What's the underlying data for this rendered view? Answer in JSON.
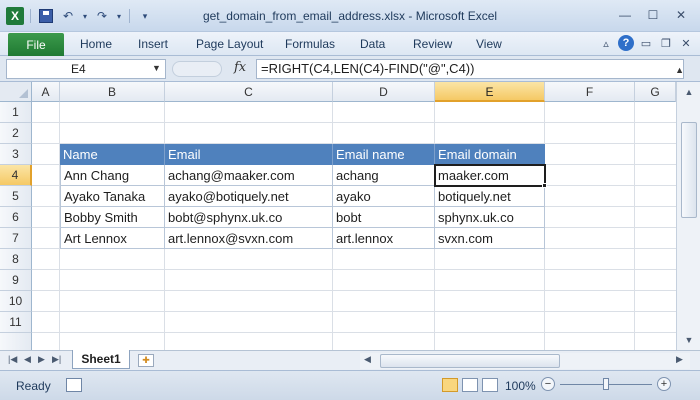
{
  "window": {
    "title": "get_domain_from_email_address.xlsx - Microsoft Excel",
    "app_icon": "excel-logo-icon"
  },
  "ribbon": {
    "file_label": "File",
    "tabs": [
      "Home",
      "Insert",
      "Page Layout",
      "Formulas",
      "Data",
      "Review",
      "View"
    ]
  },
  "formula_bar": {
    "name_box": "E4",
    "fx": "fx",
    "formula": "=RIGHT(C4,LEN(C4)-FIND(\"@\",C4))"
  },
  "sheet": {
    "columns": [
      "A",
      "B",
      "C",
      "D",
      "E",
      "F",
      "G"
    ],
    "rows": [
      "1",
      "2",
      "3",
      "4",
      "5",
      "6",
      "7",
      "8",
      "9",
      "10",
      "11"
    ],
    "active_column": "E",
    "active_row": "4",
    "table": {
      "headers": [
        "Name",
        "Email",
        "Email name",
        "Email domain"
      ],
      "rows": [
        [
          "Ann Chang",
          "achang@maaker.com",
          "achang",
          "maaker.com"
        ],
        [
          "Ayako Tanaka",
          "ayako@botiquely.net",
          "ayako",
          "botiquely.net"
        ],
        [
          "Bobby Smith",
          "bobt@sphynx.uk.co",
          "bobt",
          "sphynx.uk.co"
        ],
        [
          "Art Lennox",
          "art.lennox@svxn.com",
          "art.lennox",
          "svxn.com"
        ]
      ]
    },
    "header_color": "#4f81bd"
  },
  "sheet_tabs": {
    "active": "Sheet1"
  },
  "status_bar": {
    "ready": "Ready",
    "zoom": "100%"
  }
}
